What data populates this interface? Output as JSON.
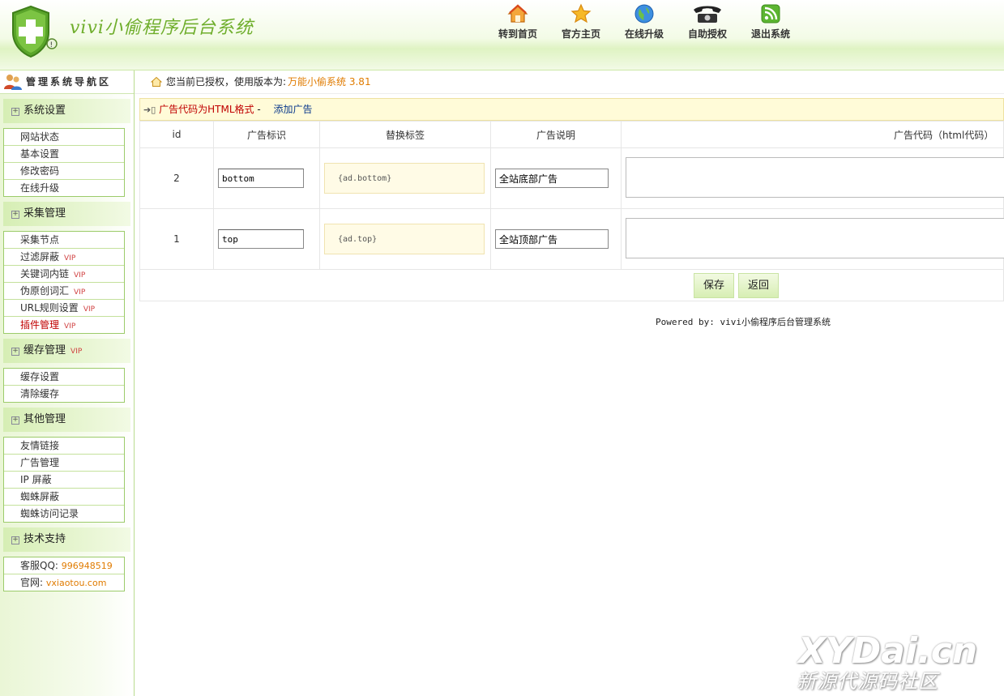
{
  "header": {
    "title": "vivi小偷程序后台系统",
    "nav": [
      {
        "label": "转到首页",
        "icon": "home-icon"
      },
      {
        "label": "官方主页",
        "icon": "star-icon"
      },
      {
        "label": "在线升级",
        "icon": "globe-icon"
      },
      {
        "label": "自助授权",
        "icon": "telephone-icon"
      },
      {
        "label": "退出系统",
        "icon": "rss-icon"
      }
    ]
  },
  "sidebar": {
    "title": "管理系统导航区",
    "groups": [
      {
        "title": "系统设置",
        "items": [
          {
            "label": "网站状态"
          },
          {
            "label": "基本设置"
          },
          {
            "label": "修改密码"
          },
          {
            "label": "在线升级"
          }
        ]
      },
      {
        "title": "采集管理",
        "items": [
          {
            "label": "采集节点"
          },
          {
            "label": "过滤屏蔽",
            "vip": "VIP"
          },
          {
            "label": "关键词内链",
            "vip": "VIP"
          },
          {
            "label": "伪原创词汇",
            "vip": "VIP"
          },
          {
            "label": "URL规则设置",
            "vip": "VIP"
          },
          {
            "label": "插件管理",
            "vip": "VIP"
          }
        ]
      },
      {
        "title": "缓存管理",
        "vip": "VIP",
        "items": [
          {
            "label": "缓存设置"
          },
          {
            "label": "清除缓存"
          }
        ]
      },
      {
        "title": "其他管理",
        "items": [
          {
            "label": "友情链接"
          },
          {
            "label": "广告管理"
          },
          {
            "label": "IP 屏蔽"
          },
          {
            "label": "蜘蛛屏蔽"
          },
          {
            "label": "蜘蛛访问记录"
          }
        ]
      },
      {
        "title": "技术支持",
        "items": [
          {
            "label": "客服QQ:",
            "value": "996948519"
          },
          {
            "label": "官网:",
            "value": "vxiaotou.com"
          }
        ]
      }
    ]
  },
  "status": {
    "text": "您当前已授权，使用版本为:",
    "value": "万能小偷系统 3.81"
  },
  "panel": {
    "title": "广告代码为HTML格式",
    "separator": "-",
    "add_link": "添加广告",
    "columns": [
      "id",
      "广告标识",
      "替换标签",
      "广告说明",
      "广告代码（html代码）"
    ],
    "rows": [
      {
        "id": "2",
        "mark": "bottom",
        "tag": "{ad.bottom}",
        "desc": "全站底部广告",
        "code": ""
      },
      {
        "id": "1",
        "mark": "top",
        "tag": "{ad.top}",
        "desc": "全站顶部广告",
        "code": ""
      }
    ],
    "save_label": "保存",
    "back_label": "返回"
  },
  "footer": {
    "text": "Powered by:  vivi小偷程序后台管理系统"
  },
  "watermark": {
    "main": "XYDai.cn",
    "sub": "新源代源码社区"
  }
}
